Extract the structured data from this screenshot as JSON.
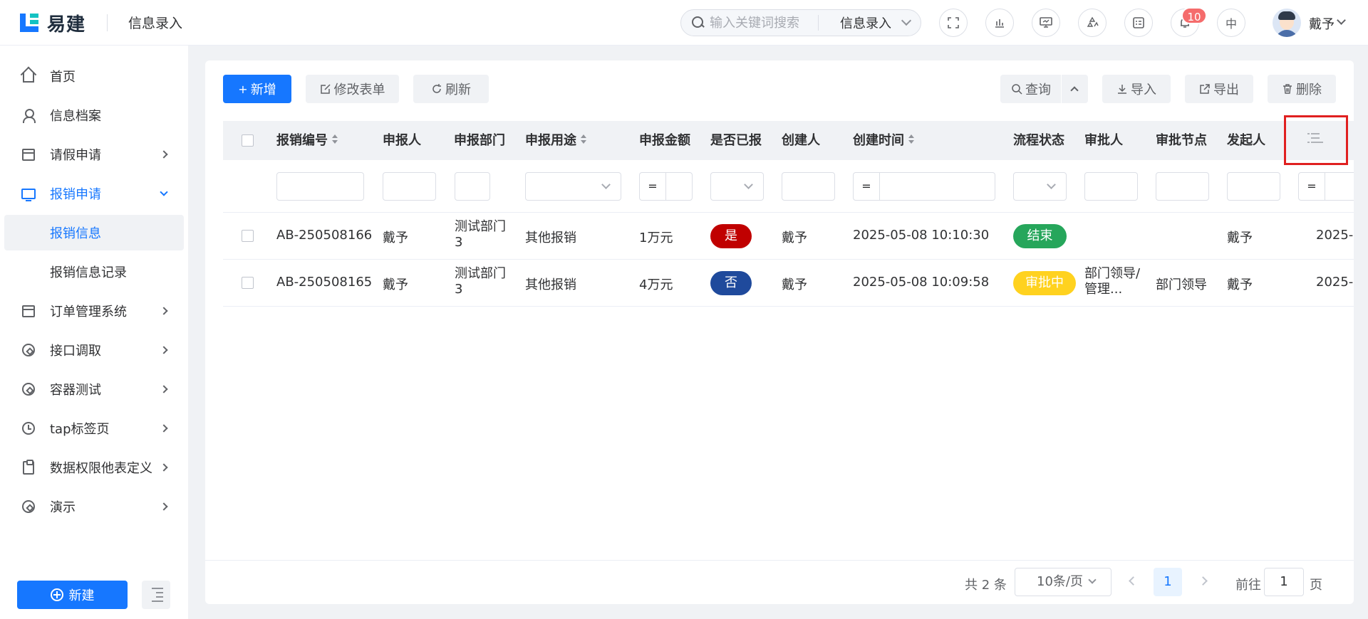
{
  "header": {
    "logo_text": "易建",
    "title": "信息录入",
    "search_placeholder": "输入关键词搜索",
    "search_scope": "信息录入",
    "notification_count": "10",
    "lang_label": "中",
    "user_name": "戴予"
  },
  "sidebar": {
    "items": [
      {
        "label": "首页",
        "icon": "home-icon"
      },
      {
        "label": "信息档案",
        "icon": "user-icon"
      },
      {
        "label": "请假申请",
        "icon": "calendar-check-icon"
      },
      {
        "label": "报销申请",
        "icon": "monitor-icon"
      },
      {
        "label": "报销信息"
      },
      {
        "label": "报销信息记录"
      },
      {
        "label": "订单管理系统",
        "icon": "calendar-icon"
      },
      {
        "label": "接口调取",
        "icon": "compass-icon"
      },
      {
        "label": "容器测试",
        "icon": "compass-icon"
      },
      {
        "label": "tap标签页",
        "icon": "clock-icon"
      },
      {
        "label": "数据权限他表定义",
        "icon": "clipboard-icon"
      },
      {
        "label": "演示",
        "icon": "compass-icon"
      }
    ],
    "new_button": "新建"
  },
  "toolbar": {
    "add": "新增",
    "edit_form": "修改表单",
    "refresh": "刷新",
    "query": "查询",
    "import": "导入",
    "export": "导出",
    "delete": "删除"
  },
  "table": {
    "columns": [
      "报销编号",
      "申报人",
      "申报部门",
      "申报用途",
      "申报金额",
      "是否已报",
      "创建人",
      "创建时间",
      "流程状态",
      "审批人",
      "审批节点",
      "发起人"
    ],
    "filter_eq": "=",
    "rows": [
      {
        "id": "AB-250508166",
        "applicant": "戴予",
        "dept": "测试部门3",
        "purpose": "其他报销",
        "amount": "1万元",
        "reported": "是",
        "creator": "戴予",
        "created_at": "2025-05-08 10:10:30",
        "status": "结束",
        "approver": "",
        "node": "",
        "initiator": "戴予",
        "extra": "2025-("
      },
      {
        "id": "AB-250508165",
        "applicant": "戴予",
        "dept": "测试部门3",
        "purpose": "其他报销",
        "amount": "4万元",
        "reported": "否",
        "creator": "戴予",
        "created_at": "2025-05-08 10:09:58",
        "status": "审批中",
        "approver": "部门领导/管理...",
        "node": "部门领导",
        "initiator": "戴予",
        "extra": "2025-("
      }
    ]
  },
  "pagination": {
    "total": "共 2 条",
    "page_size": "10条/页",
    "current": "1",
    "goto_label": "前往",
    "goto_value": "1",
    "page_suffix": "页"
  },
  "colors": {
    "primary": "#1677ff",
    "yes_tag": "#c00000",
    "no_tag": "#1f4a9c",
    "ended_tag": "#26a65b",
    "in_review_tag": "#ffd21f",
    "highlight_box": "#e02020"
  }
}
